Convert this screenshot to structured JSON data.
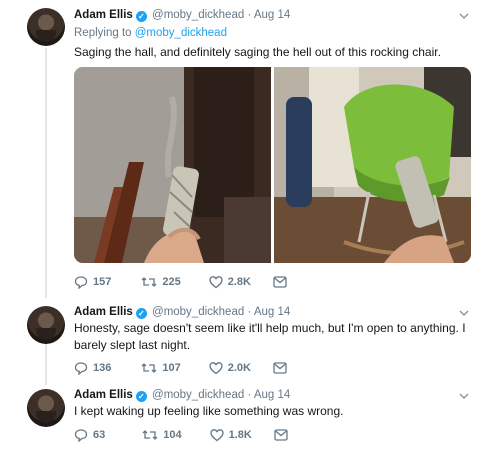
{
  "tweets": [
    {
      "author_name": "Adam Ellis",
      "verified_mark": "✓",
      "handle": "@moby_dickhead",
      "separator": "·",
      "date": "Aug 14",
      "reply_prefix": "Replying to",
      "reply_handle": "@moby_dickhead",
      "text": "Saging the hall, and definitely saging the hell out of this rocking chair.",
      "reply_count": "157",
      "retweet_count": "225",
      "like_count": "2.8K",
      "photos": [
        "photo-hall-sage",
        "photo-rocking-chair"
      ]
    },
    {
      "author_name": "Adam Ellis",
      "verified_mark": "✓",
      "handle": "@moby_dickhead",
      "separator": "·",
      "date": "Aug 14",
      "text": "Honesty, sage doesn't seem like it'll help much, but I'm open to anything. I barely slept last night.",
      "reply_count": "136",
      "retweet_count": "107",
      "like_count": "2.0K"
    },
    {
      "author_name": "Adam Ellis",
      "verified_mark": "✓",
      "handle": "@moby_dickhead",
      "separator": "·",
      "date": "Aug 14",
      "text": "I kept waking up feeling like something was wrong.",
      "reply_count": "63",
      "retweet_count": "104",
      "like_count": "1.8K"
    }
  ],
  "colors": {
    "text": "#14171a",
    "muted": "#657786",
    "link": "#1da1f2",
    "verified": "#1da1f2",
    "thread_line": "#e1e8ed",
    "chair_green": "#7cbd3b"
  },
  "icons": [
    "reply-icon",
    "retweet-icon",
    "like-icon",
    "dm-icon",
    "chevron-down-icon",
    "verified-badge-icon"
  ]
}
